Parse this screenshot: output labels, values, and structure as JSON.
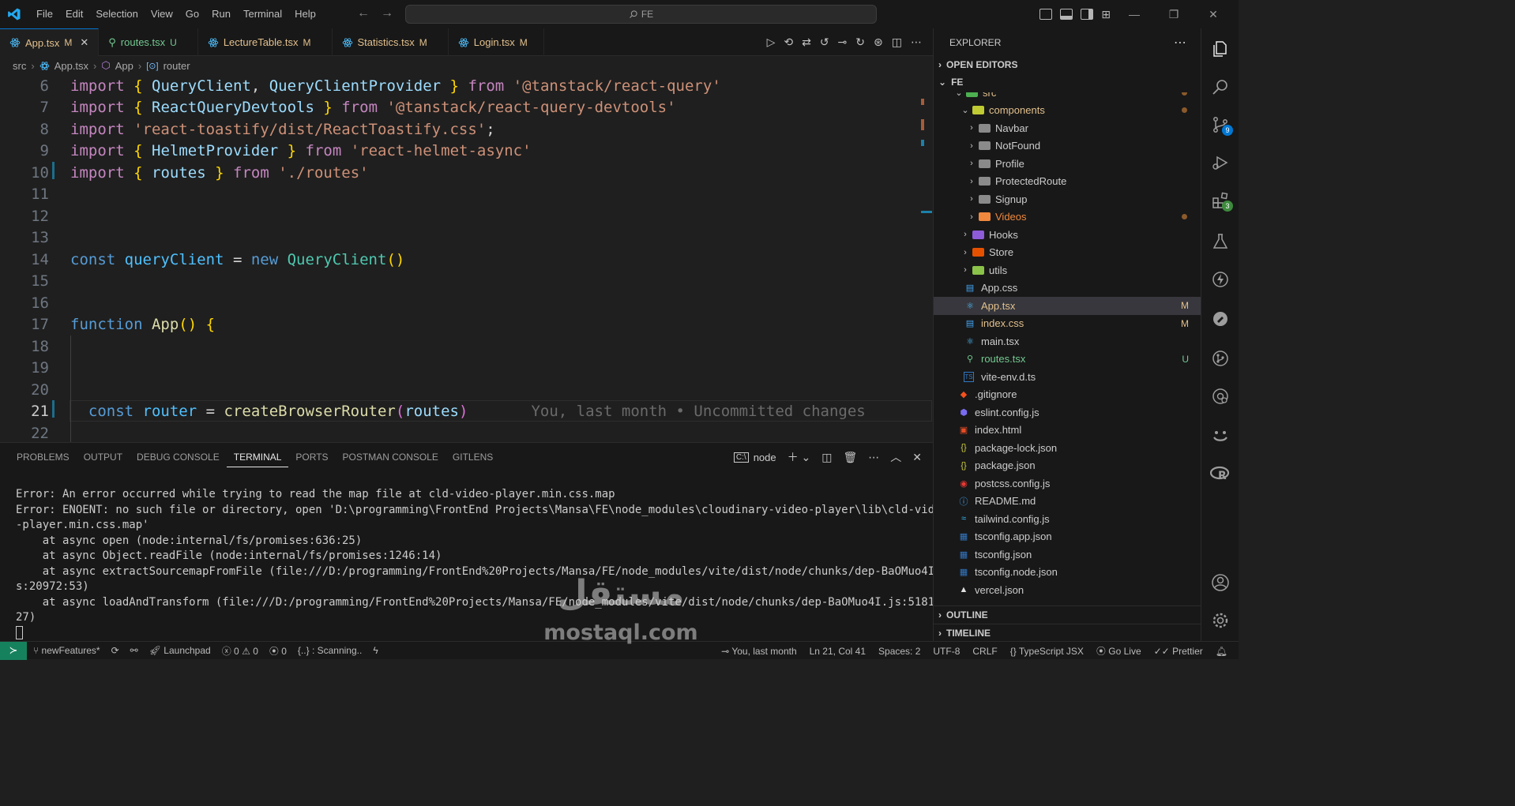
{
  "menu": [
    "File",
    "Edit",
    "Selection",
    "View",
    "Go",
    "Run",
    "Terminal",
    "Help"
  ],
  "command_center": "FE",
  "tabs": [
    {
      "name": "App.tsx",
      "status": "M",
      "kind": "modified",
      "icon": "react-icon",
      "active": true
    },
    {
      "name": "routes.tsx",
      "status": "U",
      "kind": "untracked",
      "icon": "routes-icon",
      "active": false
    },
    {
      "name": "LectureTable.tsx",
      "status": "M",
      "kind": "modified",
      "icon": "react-icon",
      "active": false
    },
    {
      "name": "Statistics.tsx",
      "status": "M",
      "kind": "modified",
      "icon": "react-icon",
      "active": false
    },
    {
      "name": "Login.tsx",
      "status": "M",
      "kind": "modified",
      "icon": "react-icon",
      "active": false
    }
  ],
  "breadcrumb": [
    "src",
    "App.tsx",
    "App",
    "router"
  ],
  "code": {
    "line_numbers": [
      "6",
      "7",
      "8",
      "9",
      "10",
      "11",
      "12",
      "13",
      "14",
      "15",
      "16",
      "17",
      "18",
      "19",
      "20",
      "21",
      "22"
    ],
    "current_line": "21",
    "blame": "You, last month • Uncommitted changes"
  },
  "panel": {
    "tabs": [
      "PROBLEMS",
      "OUTPUT",
      "DEBUG CONSOLE",
      "TERMINAL",
      "PORTS",
      "POSTMAN CONSOLE",
      "GITLENS"
    ],
    "active_tab": "TERMINAL",
    "terminal_name": "node",
    "terminal_lines": [
      "Error: An error occurred while trying to read the map file at cld-video-player.min.css.map",
      "Error: ENOENT: no such file or directory, open 'D:\\programming\\FrontEnd Projects\\Mansa\\FE\\node_modules\\cloudinary-video-player\\lib\\cld-video",
      "-player.min.css.map'",
      "    at async open (node:internal/fs/promises:636:25)",
      "    at async Object.readFile (node:internal/fs/promises:1246:14)",
      "    at async extractSourcemapFromFile (file:///D:/programming/FrontEnd%20Projects/Mansa/FE/node_modules/vite/dist/node/chunks/dep-BaOMuo4I.j",
      "s:20972:53)",
      "    at async loadAndTransform (file:///D:/programming/FrontEnd%20Projects/Mansa/FE/node_modules/vite/dist/node/chunks/dep-BaOMuo4I.js:51819:",
      "27)"
    ]
  },
  "explorer": {
    "title": "EXPLORER",
    "open_editors": "OPEN EDITORS",
    "root": "FE",
    "items": [
      {
        "label": "src",
        "type": "folder-open",
        "depth": 1,
        "color": "#e2c08d",
        "dot": true
      },
      {
        "label": "components",
        "type": "folder-open",
        "depth": 2,
        "color": "#e2c08d",
        "dot": true
      },
      {
        "label": "Navbar",
        "type": "folder",
        "depth": 3,
        "color": "#cccccc"
      },
      {
        "label": "NotFound",
        "type": "folder",
        "depth": 3,
        "color": "#cccccc"
      },
      {
        "label": "Profile",
        "type": "folder",
        "depth": 3,
        "color": "#cccccc"
      },
      {
        "label": "ProtectedRoute",
        "type": "folder",
        "depth": 3,
        "color": "#cccccc"
      },
      {
        "label": "Signup",
        "type": "folder",
        "depth": 3,
        "color": "#cccccc"
      },
      {
        "label": "Videos",
        "type": "folder",
        "depth": 3,
        "color": "#f0883e",
        "dot": true
      },
      {
        "label": "Hooks",
        "type": "folder",
        "depth": 2,
        "color": "#cccccc"
      },
      {
        "label": "Store",
        "type": "folder",
        "depth": 2,
        "color": "#cccccc"
      },
      {
        "label": "utils",
        "type": "folder",
        "depth": 2,
        "color": "#cccccc"
      },
      {
        "label": "App.css",
        "type": "file",
        "depth": 2,
        "color": "#cccccc"
      },
      {
        "label": "App.tsx",
        "type": "file",
        "depth": 2,
        "color": "#e2c08d",
        "status": "M",
        "selected": true
      },
      {
        "label": "index.css",
        "type": "file",
        "depth": 2,
        "color": "#e2c08d",
        "status": "M"
      },
      {
        "label": "main.tsx",
        "type": "file",
        "depth": 2,
        "color": "#cccccc"
      },
      {
        "label": "routes.tsx",
        "type": "file",
        "depth": 2,
        "color": "#73c991",
        "status": "U"
      },
      {
        "label": "vite-env.d.ts",
        "type": "file",
        "depth": 2,
        "color": "#cccccc"
      },
      {
        "label": ".gitignore",
        "type": "file",
        "depth": 1,
        "color": "#cccccc"
      },
      {
        "label": "eslint.config.js",
        "type": "file",
        "depth": 1,
        "color": "#cccccc"
      },
      {
        "label": "index.html",
        "type": "file",
        "depth": 1,
        "color": "#cccccc"
      },
      {
        "label": "package-lock.json",
        "type": "file",
        "depth": 1,
        "color": "#cccccc"
      },
      {
        "label": "package.json",
        "type": "file",
        "depth": 1,
        "color": "#cccccc"
      },
      {
        "label": "postcss.config.js",
        "type": "file",
        "depth": 1,
        "color": "#cccccc"
      },
      {
        "label": "README.md",
        "type": "file",
        "depth": 1,
        "color": "#cccccc"
      },
      {
        "label": "tailwind.config.js",
        "type": "file",
        "depth": 1,
        "color": "#cccccc"
      },
      {
        "label": "tsconfig.app.json",
        "type": "file",
        "depth": 1,
        "color": "#cccccc"
      },
      {
        "label": "tsconfig.json",
        "type": "file",
        "depth": 1,
        "color": "#cccccc"
      },
      {
        "label": "tsconfig.node.json",
        "type": "file",
        "depth": 1,
        "color": "#cccccc"
      },
      {
        "label": "vercel.json",
        "type": "file",
        "depth": 1,
        "color": "#cccccc"
      }
    ],
    "outline": "OUTLINE",
    "timeline": "TIMELINE"
  },
  "activity_badges": {
    "source_control": "9",
    "extensions": "3"
  },
  "statusbar": {
    "branch": "newFeatures*",
    "launchpad": "Launchpad",
    "errors": "0",
    "warnings": "0",
    "ports": "0",
    "scanning": "{..} : Scanning..",
    "blame": "You, last month",
    "position": "Ln 21, Col 41",
    "spaces": "Spaces: 2",
    "encoding": "UTF-8",
    "eol": "CRLF",
    "language": "TypeScript JSX",
    "golive": "Go Live",
    "prettier": "Prettier"
  },
  "watermark": {
    "arabic": "مستقل",
    "latin": "mostaql.com"
  }
}
